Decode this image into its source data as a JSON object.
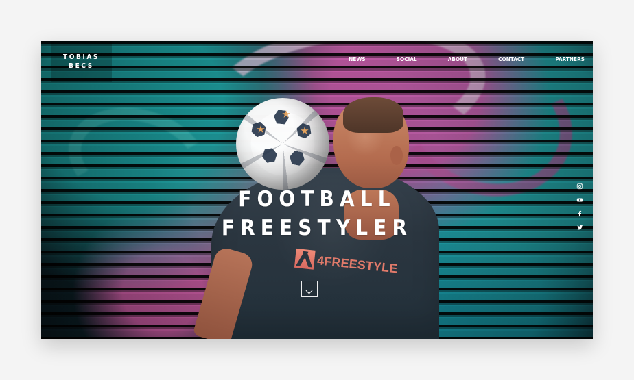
{
  "brand": {
    "line1": "TOBIAS",
    "line2": "BECS"
  },
  "nav": {
    "items": [
      "NEWS",
      "SOCIAL",
      "ABOUT",
      "CONTACT",
      "PARTNERS"
    ]
  },
  "hero": {
    "line1": "FOOTBALL",
    "line2": "FREESTYLER"
  },
  "shirt": {
    "text": "4FREESTYLE"
  },
  "social": {
    "icons": [
      "instagram-icon",
      "youtube-icon",
      "facebook-icon",
      "twitter-icon"
    ]
  }
}
